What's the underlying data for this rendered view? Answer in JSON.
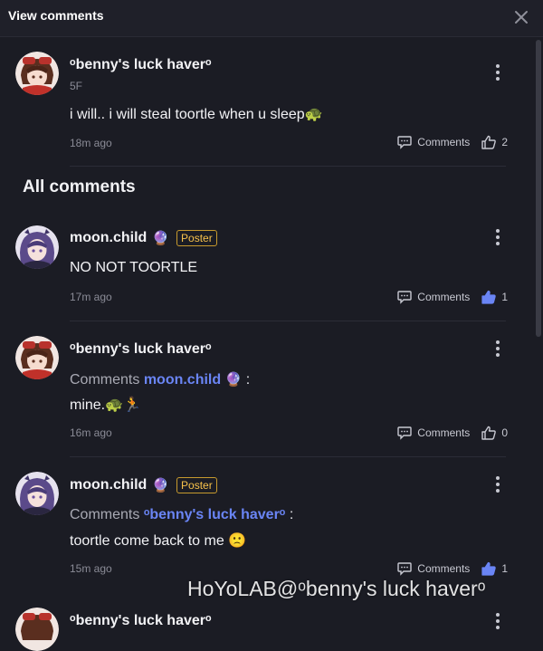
{
  "header": {
    "title": "View comments"
  },
  "section_title": "All comments",
  "watermark": "HoYoLAB@ᵒbenny's luck haverᵒ",
  "main_comment": {
    "author": "ᵒbenny's luck haverᵒ",
    "floor": "5F",
    "text": "i will.. i will steal toortle when u sleep🐢",
    "time": "18m ago",
    "comments_label": "Comments",
    "likes": "2"
  },
  "replies": [
    {
      "author": "moon.child",
      "emoji": "🔮",
      "badge": "Poster",
      "text": "NO NOT TOORTLE",
      "time": "17m ago",
      "comments_label": "Comments",
      "likes": "1",
      "liked": true
    },
    {
      "author": "ᵒbenny's luck haverᵒ",
      "reply_prefix": "Comments",
      "reply_target": "moon.child",
      "reply_target_emoji": "🔮",
      "reply_colon": ":",
      "text": "mine.🐢🏃",
      "time": "16m ago",
      "comments_label": "Comments",
      "likes": "0",
      "liked": false
    },
    {
      "author": "moon.child",
      "emoji": "🔮",
      "badge": "Poster",
      "reply_prefix": "Comments",
      "reply_target": "ᵒbenny's luck haverᵒ",
      "reply_colon": ":",
      "text": "toortle come back to me 🙁",
      "time": "15m ago",
      "comments_label": "Comments",
      "likes": "1",
      "liked": true
    },
    {
      "author": "ᵒbenny's luck haverᵒ"
    }
  ],
  "colors": {
    "accent": "#6a85f5",
    "poster_badge": "#f6c14b",
    "background": "#1b1c24"
  }
}
